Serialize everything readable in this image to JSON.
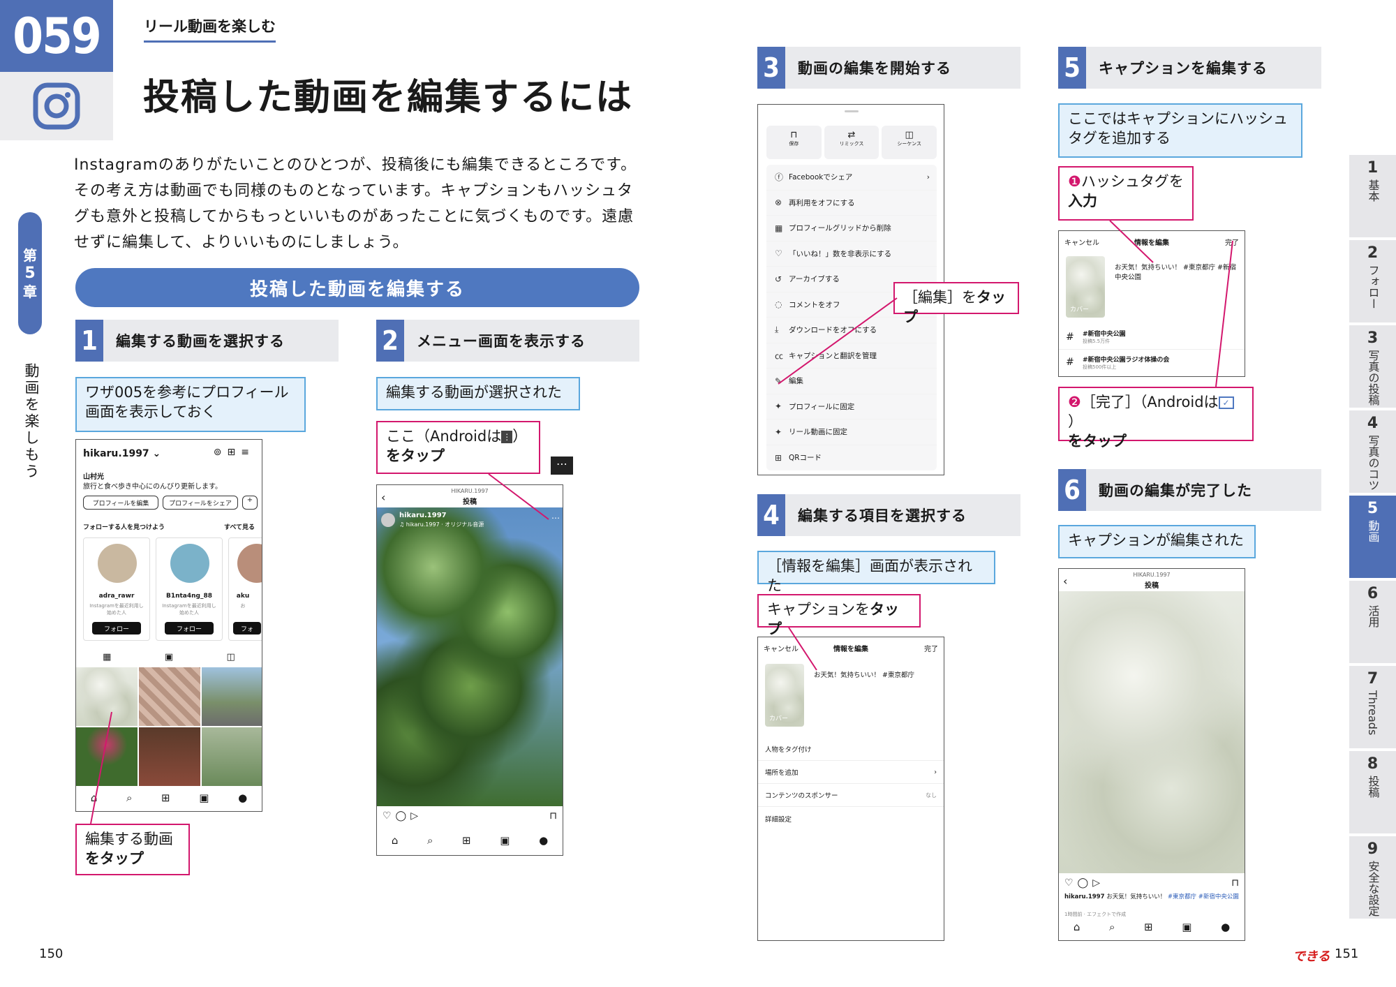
{
  "left": {
    "lesson_number": "059",
    "subtitle": "リール動画を楽しむ",
    "title": "投稿した動画を編集するには",
    "intro": "Instagramのありがたいことのひとつが、投稿後にも編集できるところです。その考え方は動画でも同様のものとなっています。キャプションもハッシュタグも意外と投稿してからもっといいものがあったことに気づくものです。遠慮せずに編集して、よりいいものにしましょう。",
    "chapter_tab": [
      "第",
      "5",
      "章"
    ],
    "chapter_label": "動画を楽しもう",
    "section_pill": "投稿した動画を編集する",
    "page_number": "150"
  },
  "steps": [
    {
      "n": "1",
      "title": "編集する動画を選択する"
    },
    {
      "n": "2",
      "title": "メニュー画面を表示する"
    },
    {
      "n": "3",
      "title": "動画の編集を開始する"
    },
    {
      "n": "4",
      "title": "編集する項目を選択する"
    },
    {
      "n": "5",
      "title": "キャプションを編集する"
    },
    {
      "n": "6",
      "title": "動画の編集が完了した"
    }
  ],
  "callouts": {
    "s1_info": "ワザ005を参考にプロフィール画面を表示しておく",
    "s1_tap_a": "編集する動画",
    "s1_tap_b": "をタップ",
    "s2_info": "編集する動画が選択された",
    "s2_tap_a": "ここ（Androidは",
    "s2_tap_a2": "）",
    "s2_tap_b": "をタップ",
    "s3_tap_a": "［編集］を",
    "s3_tap_b": "タップ",
    "s4_info": "［情報を編集］画面が表示された",
    "s4_tap_a": "キャプションを",
    "s4_tap_b": "タップ",
    "s5_info": "ここではキャプションにハッシュタグを追加する",
    "s5_c1_num": "❶",
    "s5_c1_a": "ハッシュタグを",
    "s5_c1_b": "入力",
    "s5_c2_num": "❷",
    "s5_c2_a": "［完了］（Androidは",
    "s5_c2_a2": "）",
    "s5_c2_b": "をタップ",
    "s6_info": "キャプションが編集された"
  },
  "profile": {
    "username": "hikaru.1997",
    "name": "山村光",
    "bio": "旅行と食べ歩き中心にのんびり更新します。",
    "edit_btn": "プロフィールを編集",
    "share_btn": "プロフィールをシェア",
    "discover": "フォローする人を見つけよう",
    "see_all": "すべて見る",
    "cards": [
      {
        "name": "adra_rawr",
        "desc": "Instagramを最近利用し始めた人",
        "btn": "フォロー"
      },
      {
        "name": "B1nta4ng_88",
        "desc": "Instagramを最近利用し始めた人",
        "btn": "フォロー"
      },
      {
        "name": "aku",
        "desc": "お",
        "btn": "フォ"
      }
    ]
  },
  "post_screen": {
    "header_user": "HIKARU.1997",
    "header_title": "投稿",
    "user": "hikaru.1997",
    "audio": "hikaru.1997 · オリジナル音源"
  },
  "menu": {
    "top": [
      {
        "icon": "bookmark",
        "label": "保存"
      },
      {
        "icon": "remix",
        "label": "リミックス"
      },
      {
        "icon": "sequence",
        "label": "シーケンス"
      }
    ],
    "items": [
      "Facebookでシェア",
      "再利用をオフにする",
      "プロフィールグリッドから削除",
      "「いいね！」数を非表示にする",
      "アーカイブする",
      "コメントをオフ",
      "ダウンロードをオフにする",
      "キャプションと翻訳を管理",
      "編集",
      "プロフィールに固定",
      "リール動画に固定",
      "QRコード"
    ]
  },
  "edit_info": {
    "cancel": "キャンセル",
    "title": "情報を編集",
    "done": "完了",
    "caption": "お天気！気持ちいい！ #東京都庁",
    "cover": "カバー",
    "rows": [
      {
        "label": "人物をタグ付け",
        "value": ""
      },
      {
        "label": "場所を追加",
        "value": ""
      },
      {
        "label": "コンテンツのスポンサー",
        "value": "なし"
      },
      {
        "label": "詳細設定",
        "value": ""
      }
    ]
  },
  "edit_info2": {
    "caption": "お天気！気持ちいい！ #東京都庁 #新宿中央公園",
    "tags": [
      {
        "tag": "#新宿中央公園",
        "count": "投稿5.5万件"
      },
      {
        "tag": "#新宿中央公園ラジオ体操の会",
        "count": "投稿500件以上"
      }
    ]
  },
  "final_post": {
    "caption_user": "hikaru.1997",
    "caption": "お天気！気持ちいい！",
    "tags": "#東京都庁 #新宿中央公園",
    "time": "1時間前 · エフェクトで作成"
  },
  "side_index": [
    {
      "n": "1",
      "label": "基本"
    },
    {
      "n": "2",
      "label": "フォロー"
    },
    {
      "n": "3",
      "label": "写真の投稿"
    },
    {
      "n": "4",
      "label": "写真のコツ"
    },
    {
      "n": "5",
      "label": "動画"
    },
    {
      "n": "6",
      "label": "活用"
    },
    {
      "n": "7",
      "label": "Threads"
    },
    {
      "n": "8",
      "label": "投稿"
    },
    {
      "n": "9",
      "label": "安全な設定"
    }
  ],
  "right": {
    "brand": "できる",
    "page_number": "151"
  },
  "colors": {
    "accent": "#4f6fb5",
    "callout": "#d3176d",
    "info_border": "#5aa7dd",
    "info_bg": "#e4f1fb"
  }
}
